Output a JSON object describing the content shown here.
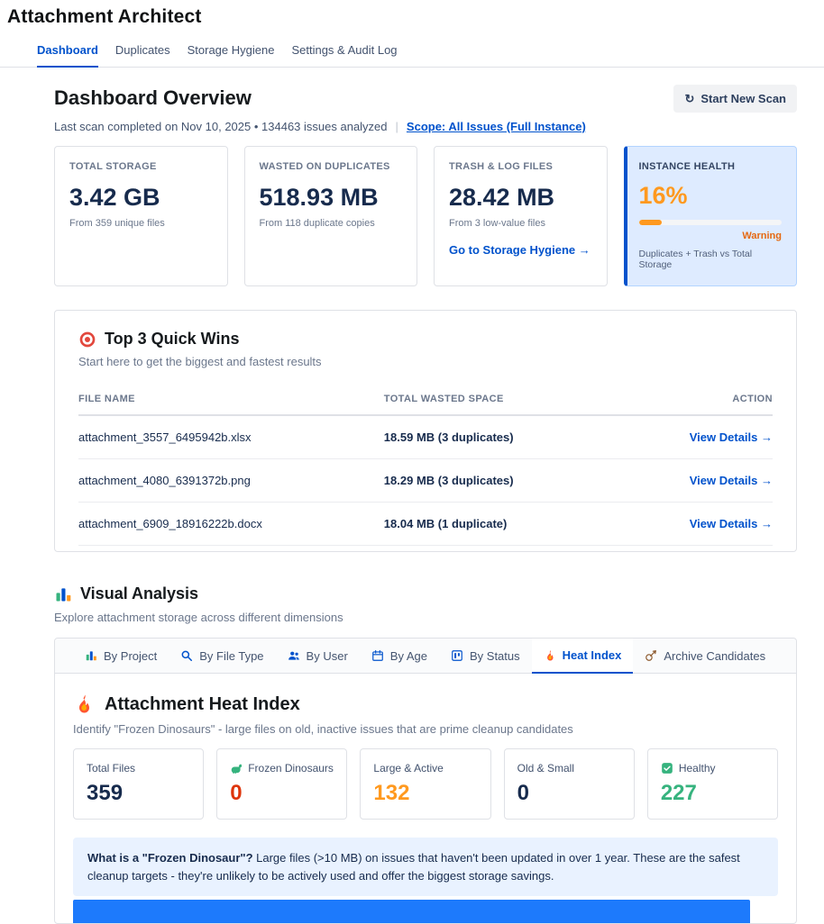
{
  "colors": {
    "accent_blue": "#0052CC",
    "warning_orange": "#FF991F",
    "danger_red": "#DE350B",
    "success_green": "#36B37E",
    "health_card_bg": "#DEEBFF",
    "info_box_bg": "#E9F2FF"
  },
  "app": {
    "title": "Attachment Architect"
  },
  "nav_tabs": [
    {
      "label": "Dashboard",
      "active": true
    },
    {
      "label": "Duplicates",
      "active": false
    },
    {
      "label": "Storage Hygiene",
      "active": false
    },
    {
      "label": "Settings & Audit Log",
      "active": false
    }
  ],
  "overview": {
    "title": "Dashboard Overview",
    "scan_status": "Last scan completed on Nov 10, 2025 • 134463 issues analyzed",
    "separator": "|",
    "scope_link": "Scope: All Issues (Full Instance)",
    "start_scan": {
      "icon": "↻",
      "label": "Start New Scan"
    }
  },
  "stats": [
    {
      "label": "TOTAL STORAGE",
      "value": "3.42 GB",
      "sub": "From 359 unique files"
    },
    {
      "label": "WASTED ON DUPLICATES",
      "value": "518.93 MB",
      "sub": "From 118 duplicate copies"
    },
    {
      "label": "TRASH & LOG FILES",
      "value": "28.42 MB",
      "sub": "From 3 low-value files",
      "link": "Go to Storage Hygiene →"
    },
    {
      "label": "INSTANCE HEALTH",
      "value": "16%",
      "progress_percent": 16,
      "status": "Warning",
      "sub": "Duplicates + Trash vs Total Storage"
    }
  ],
  "quick_wins": {
    "icon": "target-icon",
    "title": "Top 3 Quick Wins",
    "subtitle": "Start here to get the biggest and fastest results",
    "columns": {
      "file": "FILE NAME",
      "wasted": "TOTAL WASTED SPACE",
      "action": "ACTION"
    },
    "rows": [
      {
        "file": "attachment_3557_6495942b.xlsx",
        "wasted": "18.59 MB (3 duplicates)",
        "action": "View Details →"
      },
      {
        "file": "attachment_4080_6391372b.png",
        "wasted": "18.29 MB (3 duplicates)",
        "action": "View Details →"
      },
      {
        "file": "attachment_6909_18916222b.docx",
        "wasted": "18.04 MB (1 duplicate)",
        "action": "View Details →"
      }
    ]
  },
  "visual_analysis": {
    "icon": "bar-chart-icon",
    "title": "Visual Analysis",
    "subtitle": "Explore attachment storage across different dimensions",
    "tabs": [
      {
        "icon": "bar-chart-icon",
        "label": "By Project",
        "active": false
      },
      {
        "icon": "magnifier-icon",
        "label": "By File Type",
        "active": false
      },
      {
        "icon": "users-icon",
        "label": "By User",
        "active": false
      },
      {
        "icon": "calendar-icon",
        "label": "By Age",
        "active": false
      },
      {
        "icon": "kanban-icon",
        "label": "By Status",
        "active": false
      },
      {
        "icon": "flame-icon",
        "label": "Heat Index",
        "active": true
      },
      {
        "icon": "dart-icon",
        "label": "Archive Candidates",
        "active": false
      }
    ]
  },
  "heat_index": {
    "icon": "flame-icon",
    "title": "Attachment Heat Index",
    "subtitle": "Identify \"Frozen Dinosaurs\" - large files on old, inactive issues that are prime cleanup candidates",
    "stats": [
      {
        "label": "Total Files",
        "value": "359",
        "color": "#172B4D"
      },
      {
        "icon": "dinosaur-icon",
        "label": "Frozen Dinosaurs",
        "value": "0",
        "color": "#DE350B"
      },
      {
        "label": "Large & Active",
        "value": "132",
        "color": "#FF991F"
      },
      {
        "label": "Old & Small",
        "value": "0",
        "color": "#172B4D"
      },
      {
        "icon": "check-icon",
        "label": "Healthy",
        "value": "227",
        "color": "#36B37E"
      }
    ],
    "info": {
      "lead": "What is a \"Frozen Dinosaur\"?",
      "text": " Large files (>10 MB) on issues that haven't been updated in over 1 year. These are the safest cleanup targets - they're unlikely to be actively used and offer the biggest storage savings."
    }
  }
}
